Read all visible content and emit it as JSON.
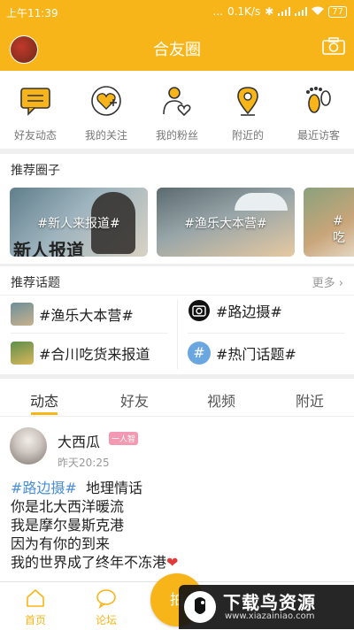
{
  "status_bar": {
    "time": "上午11:39",
    "dots": "...",
    "speed": "0.1K/s",
    "battery": "77"
  },
  "header": {
    "title": "合友圈"
  },
  "quick_nav": [
    {
      "label": "好友动态",
      "icon": "message-icon"
    },
    {
      "label": "我的关注",
      "icon": "heart-plus-icon"
    },
    {
      "label": "我的粉丝",
      "icon": "person-heart-icon"
    },
    {
      "label": "附近的",
      "icon": "location-pin-icon"
    },
    {
      "label": "最近访客",
      "icon": "footprints-icon"
    }
  ],
  "recommended_circles": {
    "title": "推荐圈子",
    "items": [
      {
        "label": "#新人来报道#",
        "banner_text": "新人报道"
      },
      {
        "label": "#渔乐大本营#"
      },
      {
        "label": "#吃"
      }
    ]
  },
  "recommended_topics": {
    "title": "推荐话题",
    "more": "更多",
    "items": [
      {
        "label": "#渔乐大本营#"
      },
      {
        "label": "#路边摄#"
      },
      {
        "label": "#合川吃货来报道"
      },
      {
        "label": "#热门话题#",
        "icon_text": "#"
      }
    ]
  },
  "feed_tabs": [
    "动态",
    "好友",
    "视频",
    "附近"
  ],
  "post": {
    "author": "大西瓜",
    "badge": "一人智",
    "time": "昨天20:25",
    "tag": "#路边摄#",
    "lines": [
      "地理情话",
      "你是北大西洋暖流",
      "我是摩尔曼斯克港",
      "因为有你的到来",
      "我的世界成了终年不冻港"
    ]
  },
  "bottom_nav": {
    "home": "首页",
    "forum": "论坛",
    "photo": "拍"
  },
  "watermark": {
    "title": "下载鸟资源",
    "url": "www.xiazainiao.com"
  },
  "colors": {
    "accent": "#f8b51a",
    "topic_blue": "#4a8fd8",
    "badge_pink": "#f39ab2"
  }
}
